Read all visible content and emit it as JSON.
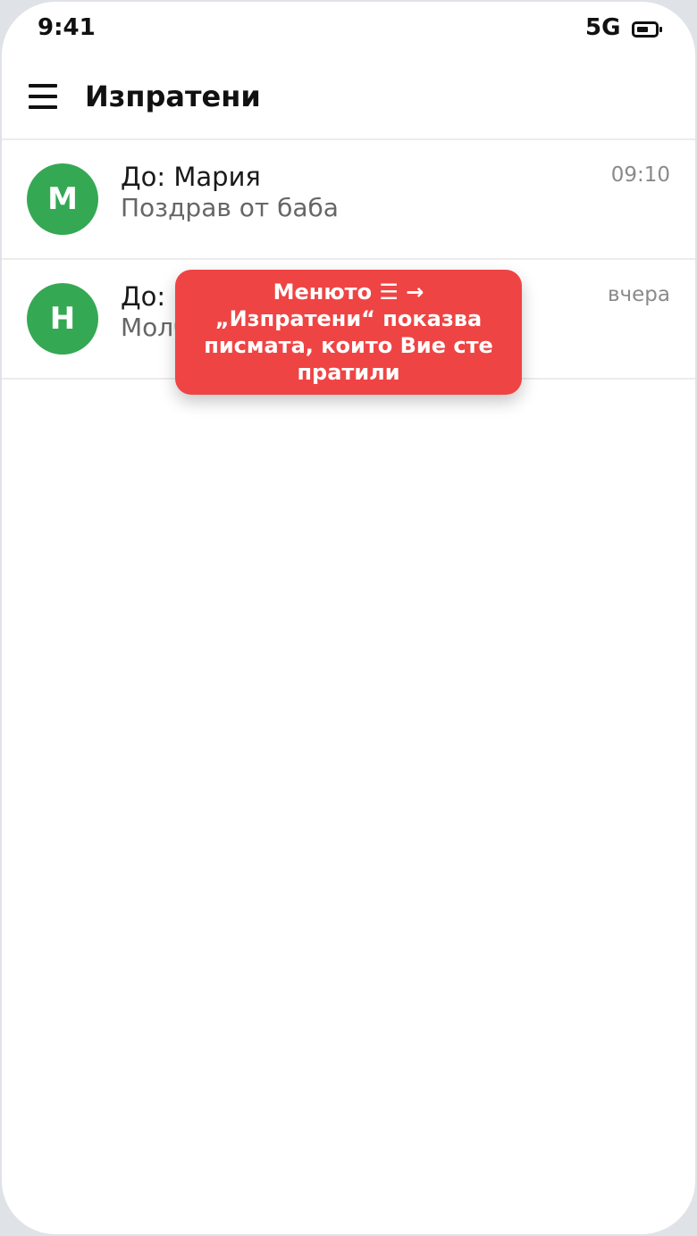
{
  "status_bar": {
    "time": "9:41",
    "network": "5G",
    "battery_icon": "battery-icon"
  },
  "app_bar": {
    "menu_icon": "menu-icon",
    "title": "Изпратени"
  },
  "messages": [
    {
      "avatar_letter": "М",
      "to": "До: Мария",
      "subject": "Поздрав от баба",
      "time": "09:10"
    },
    {
      "avatar_letter": "Н",
      "to": "До: Никола",
      "subject": "Молба",
      "time": "вчера"
    }
  ],
  "hint": {
    "text": "Менюто ☰ → „Изпратени“ показва писмата, които Вие сте пратили"
  },
  "colors": {
    "avatar": "#35a853",
    "hint_background": "#ef4444",
    "text_primary": "#111111",
    "text_secondary": "#666666"
  }
}
